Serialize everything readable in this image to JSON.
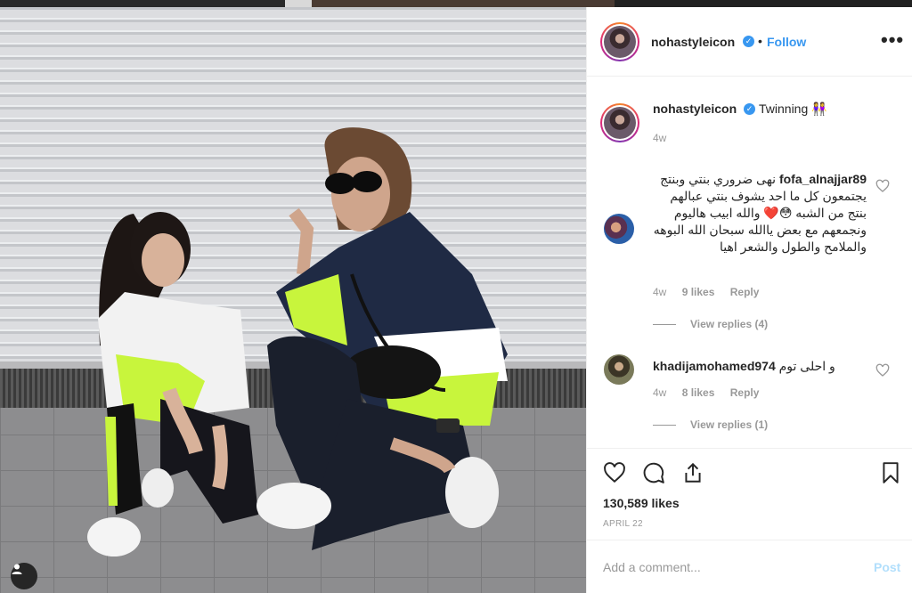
{
  "colors": {
    "accent": "#3897f0",
    "text": "#262626",
    "muted": "#999999",
    "post_disabled": "#b2dffc"
  },
  "header": {
    "username": "nohastyleicon",
    "verified_icon": "verified-badge-icon",
    "separator": "•",
    "follow_label": "Follow",
    "more_label": "•••"
  },
  "caption": {
    "username": "nohastyleicon",
    "text": "Twinning 👭",
    "time": "4w"
  },
  "comments": [
    {
      "username": "fofa_alnajjar89",
      "text": "نهى ضروري بنتي وبنتج يجتمعون كل ما احد يشوف بنتي عبالهم بنتج من الشبه 😳❤️ والله ابيب هاليوم ونجمعهم مع بعض ياالله سبحان الله البوهه والملامح والطول والشعر اهيا",
      "time": "4w",
      "likes": "9 likes",
      "reply": "Reply",
      "view_replies": "View replies (4)"
    },
    {
      "username": "khadijamohamed974",
      "text": "و احلى توم",
      "time": "4w",
      "likes": "8 likes",
      "reply": "Reply",
      "view_replies": "View replies (1)"
    }
  ],
  "actions": {
    "like_icon": "heart-icon",
    "comment_icon": "comment-icon",
    "share_icon": "share-icon",
    "save_icon": "bookmark-icon"
  },
  "likes_count": "130,589 likes",
  "post_date": "APRIL 22",
  "comment_box": {
    "placeholder": "Add a comment...",
    "post_label": "Post"
  }
}
